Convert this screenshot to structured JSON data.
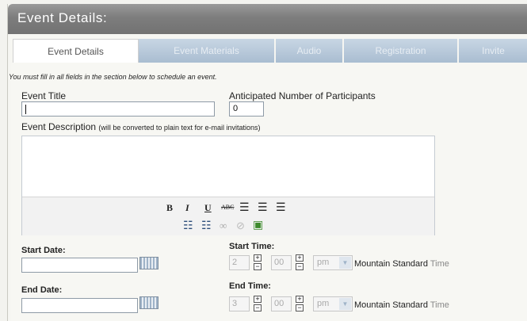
{
  "window": {
    "title": "Event Details:"
  },
  "tabs": [
    {
      "label": "Event Details",
      "active": true
    },
    {
      "label": "Event Materials"
    },
    {
      "label": "Audio"
    },
    {
      "label": "Registration"
    },
    {
      "label": "Invite"
    }
  ],
  "form": {
    "notice": "You must fill in all fields in the section below to schedule an event.",
    "event_title_label": "Event Title",
    "event_title_value": "",
    "participants_label": "Anticipated Number of Participants",
    "participants_value": "0",
    "description_label": "Event Description",
    "description_note": "(will be converted to plain text for e-mail invitations)",
    "start_date_label": "Start Date:",
    "end_date_label": "End Date:",
    "start_time_label": "Start Time:",
    "end_time_label": "End Time:",
    "start_hour": "2",
    "start_minute": "00",
    "start_ampm": "pm",
    "end_hour": "3",
    "end_minute": "00",
    "end_ampm": "pm",
    "timezone_main": "Mountain Standard",
    "timezone_suffix": "Time"
  },
  "toolbar": {
    "bold": "B",
    "italic": "I",
    "underline": "U",
    "strike": "ABC",
    "align_left": "☰",
    "align_center": "☰",
    "align_right": "☰",
    "bullets": "☷",
    "numbers": "☷",
    "link": "∞",
    "unlink": "⊘",
    "image": "▣"
  },
  "colors": {
    "accent": "#a9bdd1",
    "title_bar": "#7d7d7d"
  }
}
